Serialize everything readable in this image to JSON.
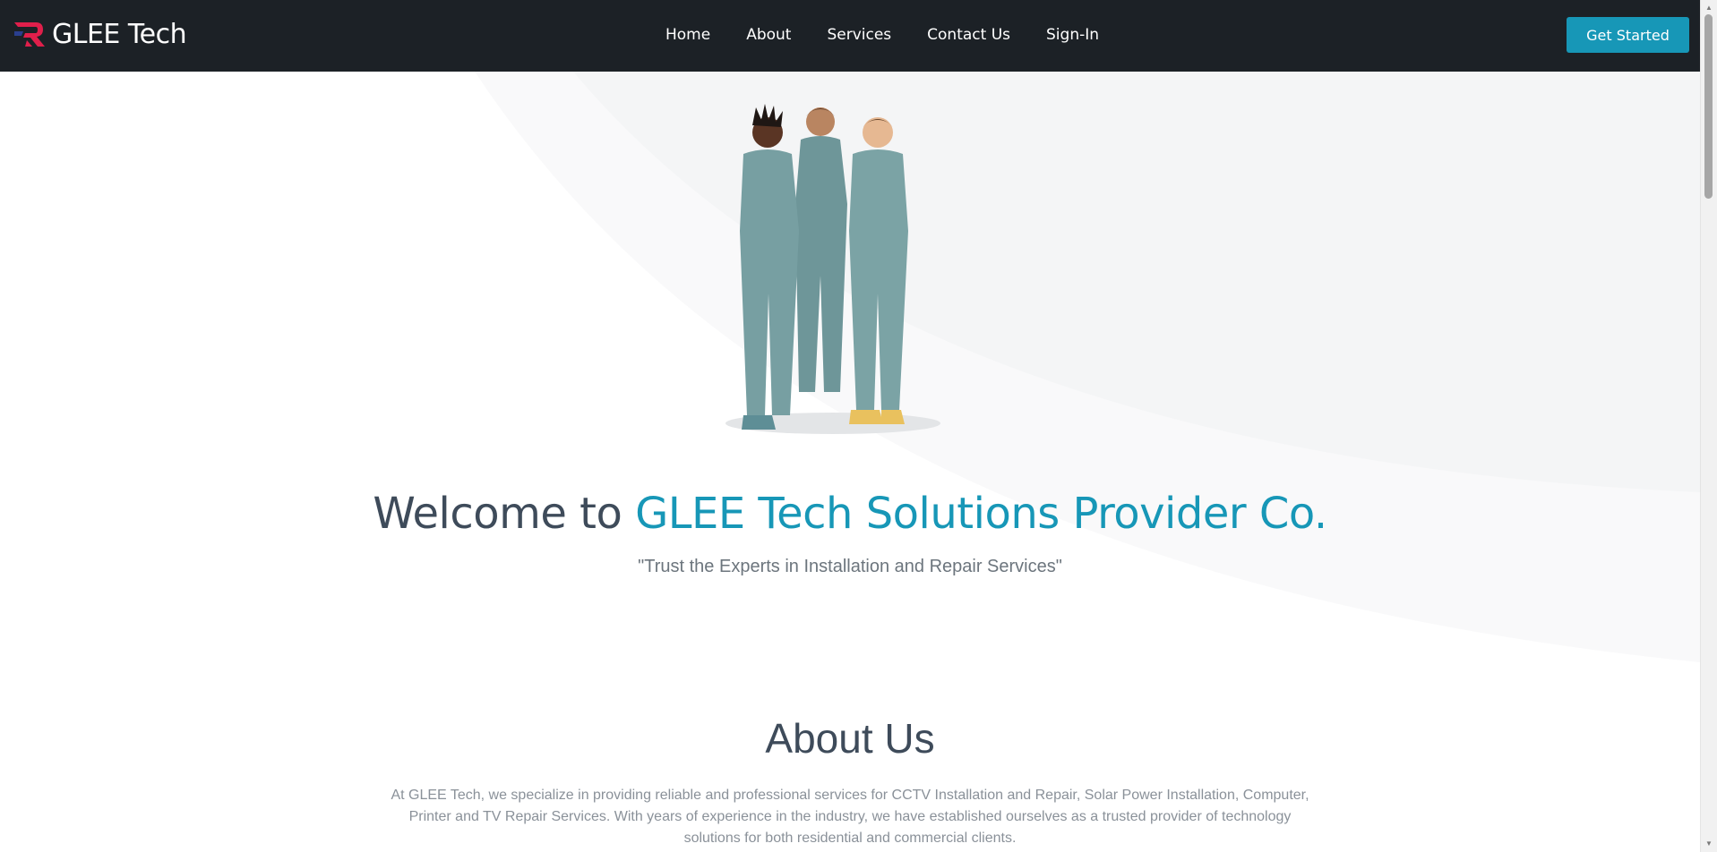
{
  "header": {
    "brand": "GLEE Tech",
    "nav": [
      "Home",
      "About",
      "Services",
      "Contact Us",
      "Sign-In"
    ],
    "cta": "Get Started"
  },
  "hero": {
    "title_lead": "Welcome to ",
    "title_accent": "GLEE Tech Solutions Provider Co.",
    "tagline": "\"Trust the Experts in Installation and Repair Services\""
  },
  "about": {
    "title": "About Us",
    "text": "At GLEE Tech, we specialize in providing reliable and professional services for CCTV Installation and Repair, Solar Power Installation, Computer, Printer and TV Repair Services. With years of experience in the industry, we have established ourselves as a trusted provider of technology solutions for both residential and commercial clients."
  },
  "colors": {
    "navbar": "#1c2126",
    "accent": "#1797b7",
    "logo": "#e01f4b"
  },
  "icons": {
    "logo": "glee-tech-logo-icon",
    "scroll_up": "scroll-up-arrow-icon",
    "scroll_down": "scroll-down-arrow-icon"
  }
}
